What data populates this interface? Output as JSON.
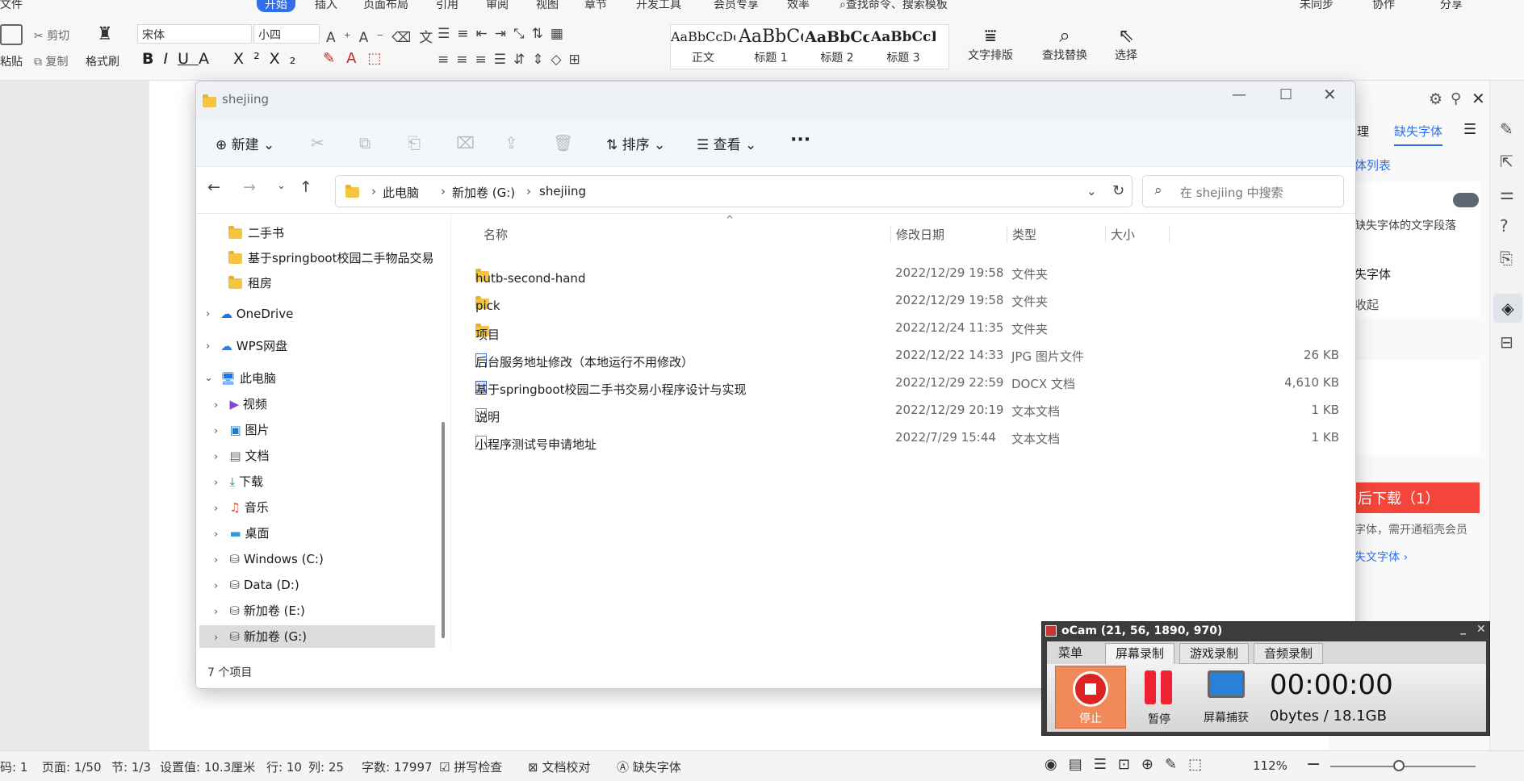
{
  "wps": {
    "menu": [
      "文件",
      "开始",
      "插入",
      "页面布局",
      "引用",
      "审阅",
      "视图",
      "章节",
      "开发工具",
      "会员专享",
      "效率"
    ],
    "search_placeholder": "查找命令、搜索模板",
    "sync": "未同步",
    "collab": "协作",
    "share": "分享",
    "paste": "粘贴",
    "cut": "剪切",
    "copy": "复制",
    "format_painter": "格式刷",
    "font": "宋体",
    "size": "小四",
    "styles": [
      {
        "sample": "AaBbCcDd",
        "label": "正文"
      },
      {
        "sample": "AaBbCc",
        "label": "标题 1"
      },
      {
        "sample": "AaBbCcI",
        "label": "标题 2"
      },
      {
        "sample": "AaBbCcDd",
        "label": "标题 3"
      }
    ],
    "text_layout": "文字排版",
    "find_replace": "查找替换",
    "select": "选择",
    "panel": {
      "tab1": "理",
      "tab2": "缺失字体",
      "list": "体列表",
      "desc": "缺失字体的文字段落",
      "item1": "失字体",
      "item2": "收起",
      "download": "后下载（1）",
      "note": "字体，需开通稻壳会员",
      "link": "失文字体 ›"
    }
  },
  "status": {
    "code": "码: 1",
    "page": "页面: 1/50",
    "section": "节: 1/3",
    "setting": "设置值: 10.3厘米",
    "row": "行: 10",
    "col": "列: 25",
    "words": "字数: 17997",
    "spell": "拼写检查",
    "proof": "文档校对",
    "missing": "缺失字体",
    "zoom": "112%"
  },
  "explorer": {
    "title": "shejiing",
    "toolbar": {
      "new": "新建",
      "sort": "排序",
      "view": "查看",
      "more": "···"
    },
    "breadcrumb": [
      "此电脑",
      "新加卷 (G:)",
      "shejiing"
    ],
    "search_placeholder": "在 shejiing 中搜索",
    "nav": {
      "f1": "二手书",
      "f2": "基于springboot校园二手物品交易",
      "f3": "租房",
      "onedrive": "OneDrive",
      "wps": "WPS网盘",
      "pc": "此电脑",
      "video": "视频",
      "pics": "图片",
      "docs": "文档",
      "dl": "下载",
      "music": "音乐",
      "desktop": "桌面",
      "c": "Windows (C:)",
      "d": "Data (D:)",
      "e": "新加卷 (E:)",
      "g": "新加卷 (G:)"
    },
    "columns": {
      "name": "名称",
      "date": "修改日期",
      "type": "类型",
      "size": "大小"
    },
    "files": [
      {
        "name": "hutb-second-hand",
        "date": "2022/12/29 19:58",
        "type": "文件夹",
        "size": ""
      },
      {
        "name": "pick",
        "date": "2022/12/29 19:58",
        "type": "文件夹",
        "size": ""
      },
      {
        "name": "项目",
        "date": "2022/12/24 11:35",
        "type": "文件夹",
        "size": ""
      },
      {
        "name": "后台服务地址修改（本地运行不用修改）",
        "date": "2022/12/22 14:33",
        "type": "JPG 图片文件",
        "size": "26 KB"
      },
      {
        "name": "基于springboot校园二手书交易小程序设计与实现",
        "date": "2022/12/29 22:59",
        "type": "DOCX 文档",
        "size": "4,610 KB"
      },
      {
        "name": "说明",
        "date": "2022/12/29 20:19",
        "type": "文本文档",
        "size": "1 KB"
      },
      {
        "name": "小程序测试号申请地址",
        "date": "2022/7/29 15:44",
        "type": "文本文档",
        "size": "1 KB"
      }
    ],
    "count": "7 个项目"
  },
  "ocam": {
    "title": "oCam (21, 56, 1890, 970)",
    "tabs": [
      "菜单",
      "屏幕录制",
      "游戏录制",
      "音频录制"
    ],
    "stop": "停止",
    "pause": "暂停",
    "capture": "屏幕捕获",
    "time": "00:00:00",
    "size": "0bytes / 18.1GB"
  }
}
